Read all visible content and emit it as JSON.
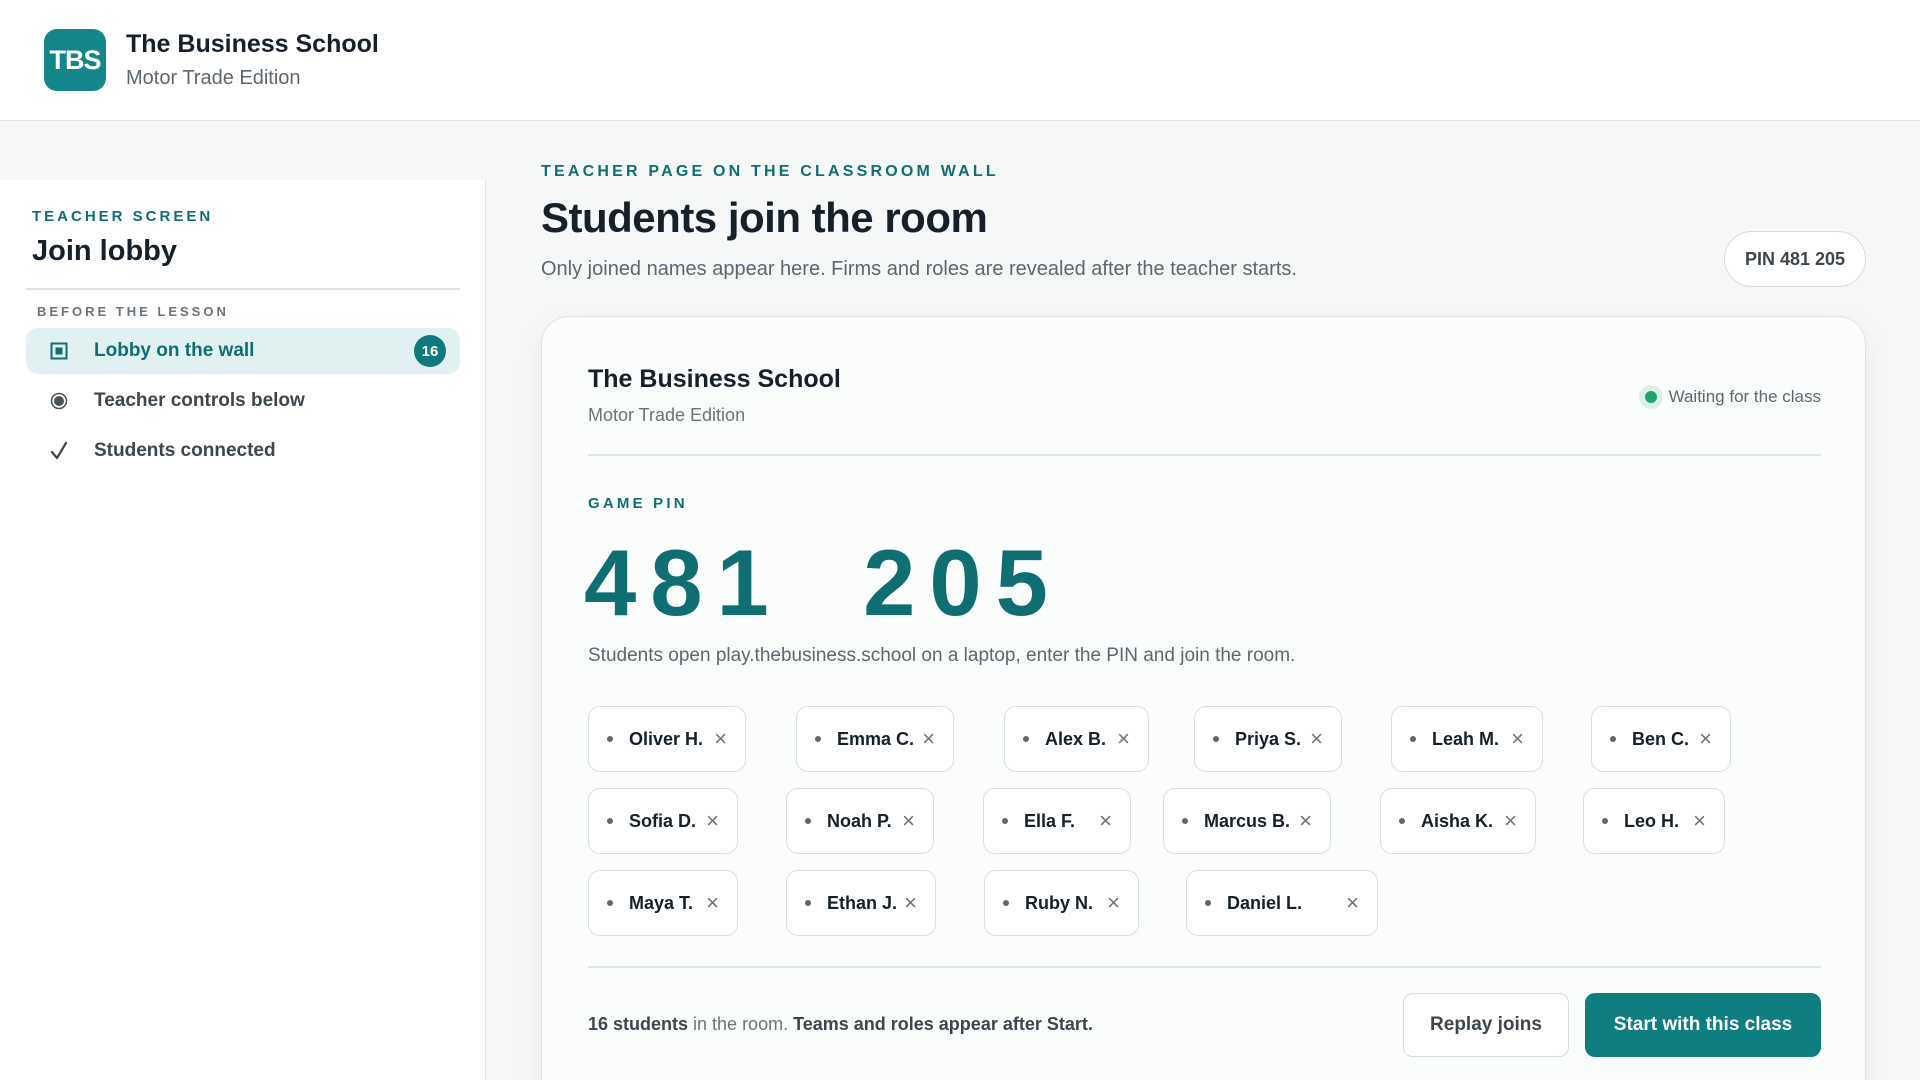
{
  "header": {
    "logo_text": "TBS",
    "title": "The Business School",
    "subtitle": "Motor Trade Edition"
  },
  "sidebar": {
    "kicker": "TEACHER SCREEN",
    "title": "Join lobby",
    "section": "BEFORE THE LESSON",
    "items": [
      {
        "label": "Lobby on the wall",
        "icon": "screen-icon",
        "count": "16",
        "active": true
      },
      {
        "label": "Teacher controls below",
        "icon": "radio-icon",
        "active": false
      },
      {
        "label": "Students connected",
        "icon": "check-icon",
        "active": false
      }
    ]
  },
  "main": {
    "kicker": "TEACHER PAGE ON THE CLASSROOM WALL",
    "title": "Students join the room",
    "subtitle": "Only joined names appear here. Firms and roles are revealed after the teacher starts.",
    "pin_pill": "PIN 481 205"
  },
  "card": {
    "title": "The Business School",
    "subtitle": "Motor Trade Edition",
    "status": "Waiting for the class",
    "pin_label": "GAME PIN",
    "pin": "481  205",
    "help": "Students open play.thebusiness.school on a laptop, enter the PIN and join the room.",
    "students": [
      "Oliver H.",
      "Emma C.",
      "Alex B.",
      "Priya S.",
      "Leah M.",
      "Ben C.",
      "Sofia D.",
      "Noah P.",
      "Ella F.",
      "Marcus B.",
      "Aisha K.",
      "Leo H.",
      "Maya T.",
      "Ethan J.",
      "Ruby N.",
      "Daniel L."
    ],
    "remove_glyph": "×",
    "footer": {
      "count_bold": "16 students",
      "count_rest": " in the room. ",
      "note_bold": "Teams and roles appear after Start."
    },
    "replay_button": "Replay joins",
    "start_button": "Start with this class"
  },
  "colors": {
    "accent": "#0f6e72",
    "accent_button": "#0f7e81",
    "status_green": "#1fa36a",
    "active_bg": "#e1f1f1"
  }
}
